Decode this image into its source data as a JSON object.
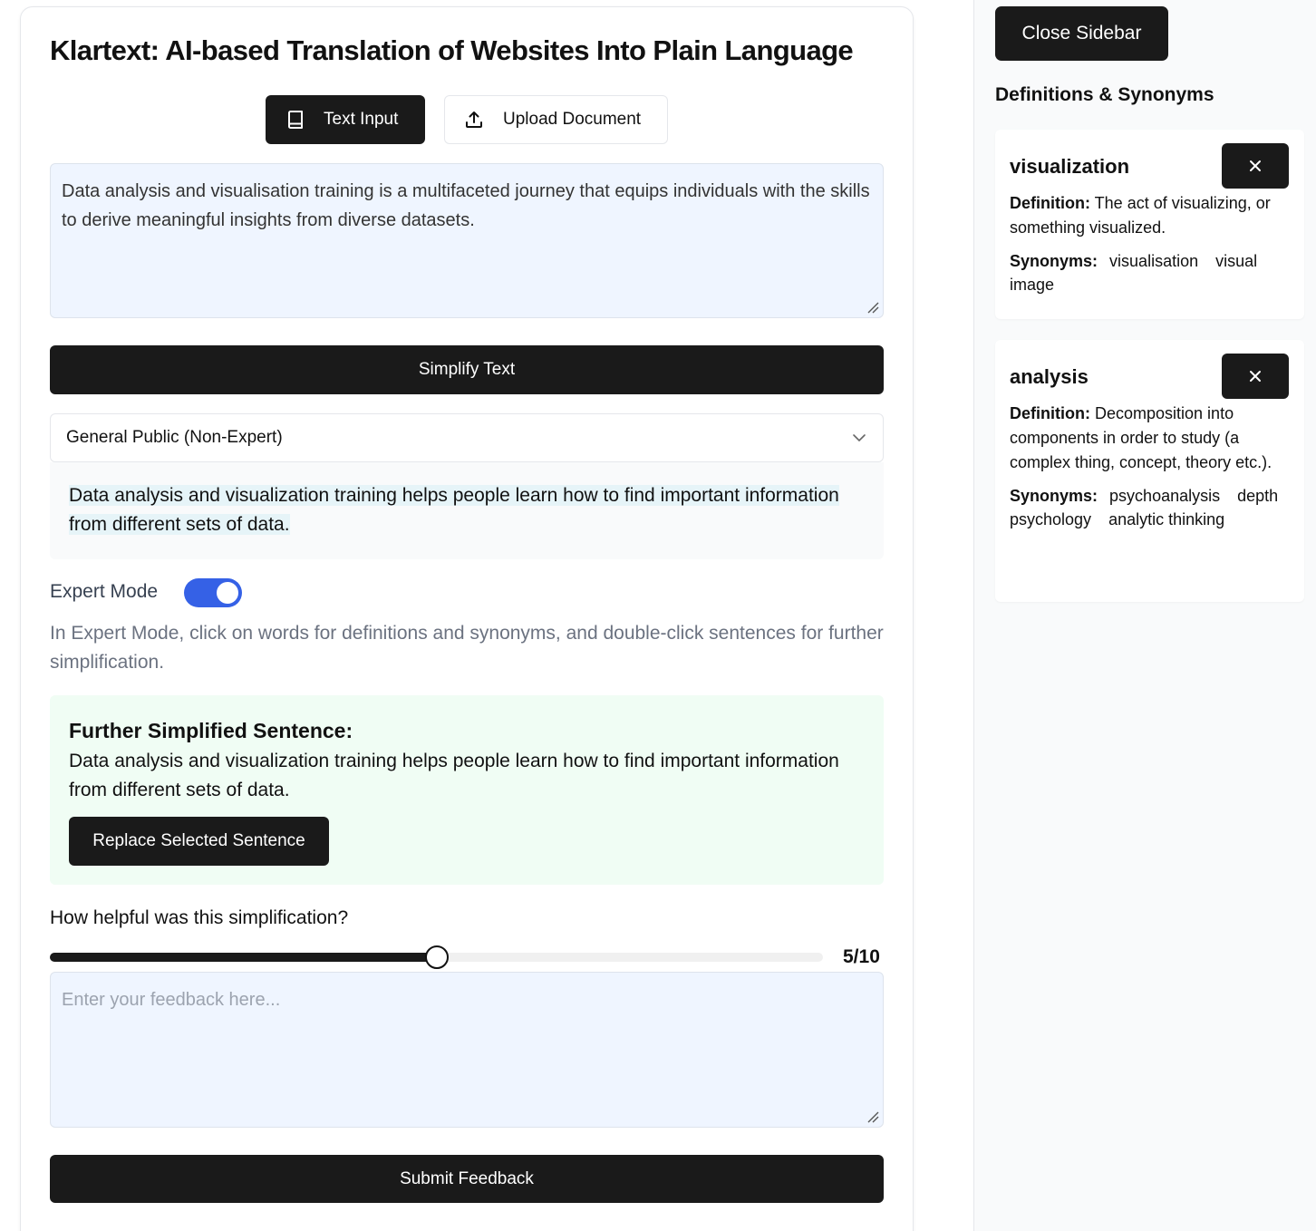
{
  "app": {
    "title": "Klartext: AI-based Translation of Websites Into Plain Language"
  },
  "tabs": {
    "text_input": "Text Input",
    "upload_document": "Upload Document"
  },
  "input": {
    "value": "Data analysis and visualisation training is a multifaceted journey that equips individuals with the skills to derive meaningful insights from diverse datasets."
  },
  "simplify_button": "Simplify Text",
  "audience_select": {
    "selected": "General Public (Non-Expert)"
  },
  "output": {
    "text": "Data analysis and visualization training helps people learn how to find important information from different sets of data."
  },
  "expert_mode": {
    "label": "Expert Mode",
    "enabled": true,
    "help": "In Expert Mode, click on words for definitions and synonyms, and double-click sentences for further simplification."
  },
  "further_simplified": {
    "title": "Further Simplified Sentence:",
    "text": "Data analysis and visualization training helps people learn how to find important information from different sets of data.",
    "replace_button": "Replace Selected Sentence"
  },
  "rating": {
    "question": "How helpful was this simplification?",
    "value": 5,
    "max": 10,
    "display": "5/10"
  },
  "feedback": {
    "placeholder": "Enter your feedback here...",
    "submit": "Submit Feedback"
  },
  "sidebar": {
    "close_button": "Close Sidebar",
    "heading": "Definitions & Synonyms",
    "definition_label": "Definition:",
    "synonyms_label": "Synonyms:",
    "cards": [
      {
        "word": "visualization",
        "definition": "The act of visualizing, or something visualized.",
        "synonyms": [
          "visualisation",
          "visual image"
        ]
      },
      {
        "word": "analysis",
        "definition": "Decomposition into components in order to study (a complex thing, concept, theory etc.).",
        "synonyms": [
          "psychoanalysis",
          "depth psychology",
          "analytic thinking"
        ]
      }
    ]
  },
  "icons": {
    "text_input_tab": "book-icon",
    "upload_tab": "upload-icon",
    "select": "chevron-down-icon",
    "card_close": "close-icon"
  },
  "colors": {
    "primary_dark": "#1a1a1a",
    "toggle_on": "#3561e6",
    "input_bg": "#eff5ff",
    "green_box_bg": "#f0fdf4"
  }
}
